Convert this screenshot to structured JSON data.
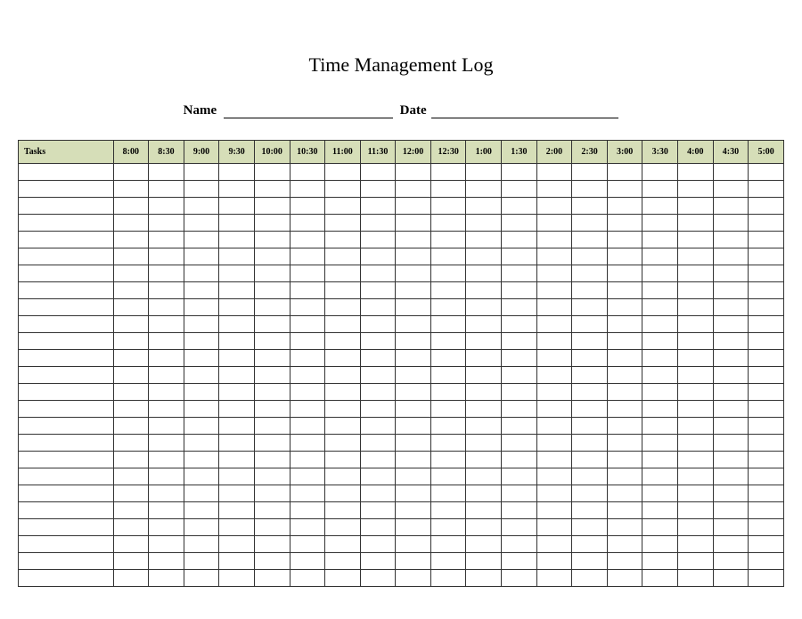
{
  "title": "Time Management Log",
  "fields": {
    "name_label": "Name",
    "date_label": "Date"
  },
  "table": {
    "tasks_header": "Tasks",
    "time_headers": [
      "8:00",
      "8:30",
      "9:00",
      "9:30",
      "10:00",
      "10:30",
      "11:00",
      "11:30",
      "12:00",
      "12:30",
      "1:00",
      "1:30",
      "2:00",
      "2:30",
      "3:00",
      "3:30",
      "4:00",
      "4:30",
      "5:00"
    ],
    "row_count": 25
  },
  "colors": {
    "header_bg": "#d6deb8",
    "border": "#333333",
    "text": "#000000",
    "background": "#ffffff"
  }
}
